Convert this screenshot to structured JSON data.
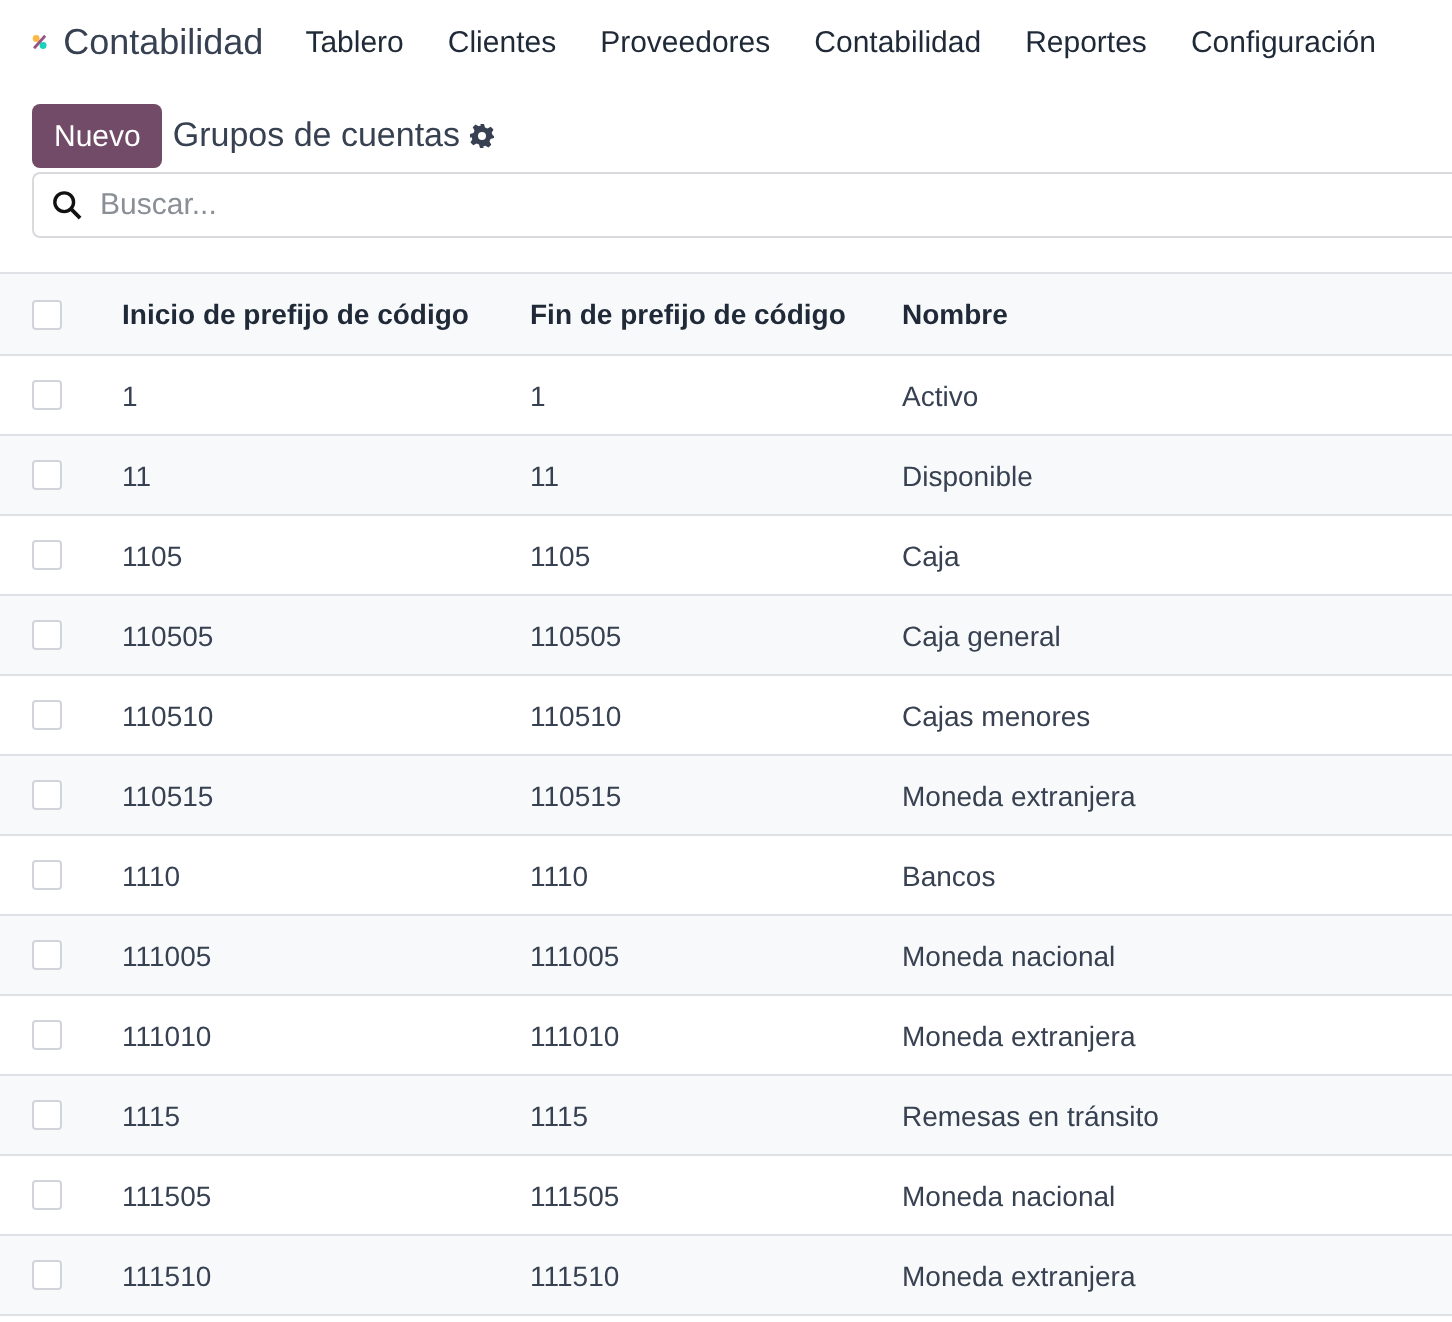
{
  "app": {
    "name": "Contabilidad"
  },
  "menu": [
    "Tablero",
    "Clientes",
    "Proveedores",
    "Contabilidad",
    "Reportes",
    "Configuración"
  ],
  "control_panel": {
    "new_button": "Nuevo",
    "title": "Grupos de cuentas"
  },
  "search": {
    "placeholder": "Buscar..."
  },
  "table": {
    "columns": [
      "Inicio de prefijo de código",
      "Fin de prefijo de código",
      "Nombre"
    ],
    "all_checked": false,
    "rows": [
      {
        "cells": [
          "1",
          "1",
          "Activo"
        ],
        "checked": false
      },
      {
        "cells": [
          "11",
          "11",
          "Disponible"
        ],
        "checked": false
      },
      {
        "cells": [
          "1105",
          "1105",
          "Caja"
        ],
        "checked": false
      },
      {
        "cells": [
          "110505",
          "110505",
          "Caja general"
        ],
        "checked": false
      },
      {
        "cells": [
          "110510",
          "110510",
          "Cajas menores"
        ],
        "checked": false
      },
      {
        "cells": [
          "110515",
          "110515",
          "Moneda extranjera"
        ],
        "checked": false
      },
      {
        "cells": [
          "1110",
          "1110",
          "Bancos"
        ],
        "checked": false
      },
      {
        "cells": [
          "111005",
          "111005",
          "Moneda nacional"
        ],
        "checked": false
      },
      {
        "cells": [
          "111010",
          "111010",
          "Moneda extranjera"
        ],
        "checked": false
      },
      {
        "cells": [
          "1115",
          "1115",
          "Remesas en tránsito"
        ],
        "checked": false
      },
      {
        "cells": [
          "111505",
          "111505",
          "Moneda nacional"
        ],
        "checked": false
      },
      {
        "cells": [
          "111510",
          "111510",
          "Moneda extranjera"
        ],
        "checked": false
      }
    ]
  }
}
